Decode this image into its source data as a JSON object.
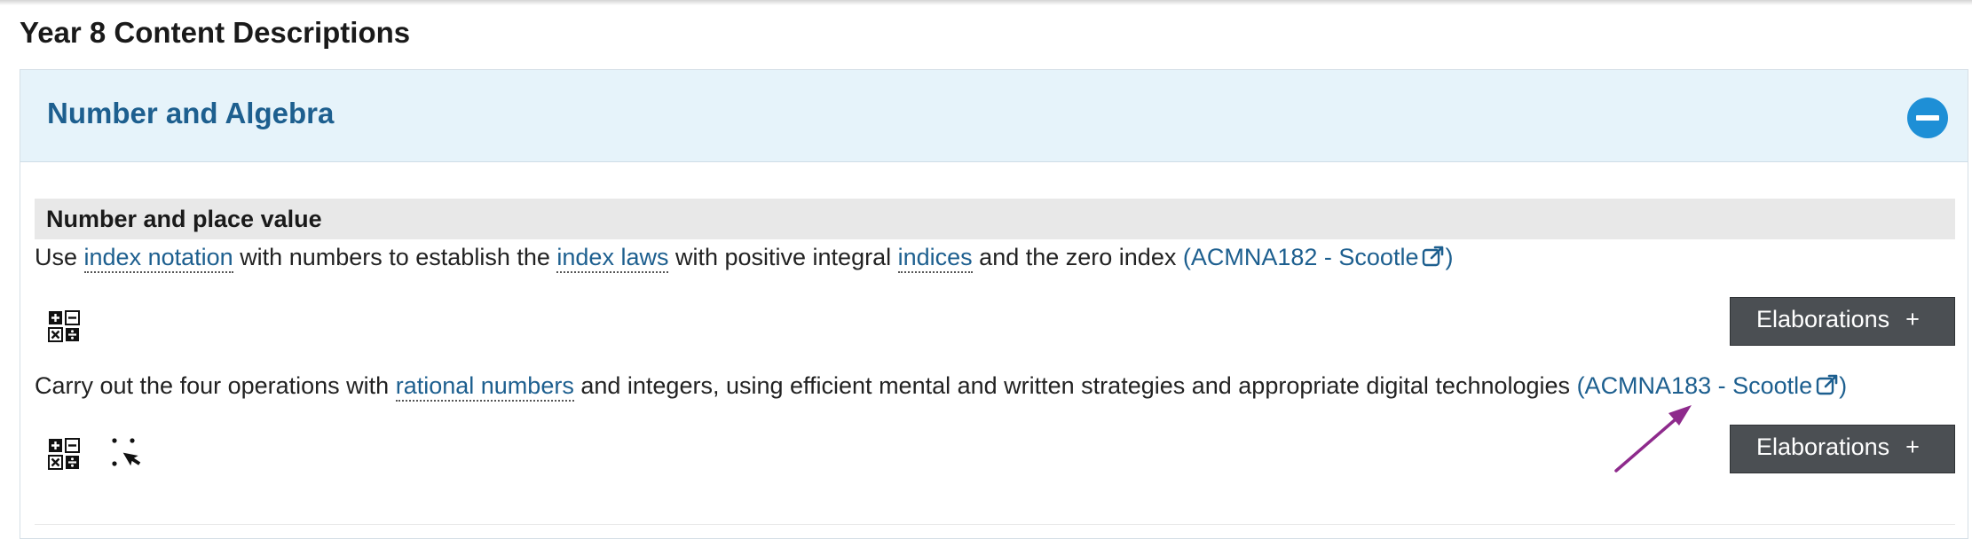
{
  "page": {
    "title": "Year 8 Content Descriptions"
  },
  "strand": {
    "title": "Number and Algebra",
    "collapse_icon": "minus-circle-icon",
    "accent_color": "#1e8fd6",
    "header_bg": "#e6f3fa"
  },
  "substrand": {
    "title": "Number and place value"
  },
  "descriptions": [
    {
      "parts": {
        "t1": "Use",
        "l1": "index notation",
        "t2": "with numbers to establish the",
        "l2": "index laws",
        "t3": "with positive integral",
        "l3": "indices",
        "t4": "and the zero index",
        "code_open": "(ACMNA182 - Scootle",
        "code_close": ")"
      },
      "icons": [
        "numeracy-icon"
      ],
      "button": {
        "label": "Elaborations",
        "plus": "+"
      }
    },
    {
      "parts": {
        "t1": "Carry out the four operations with",
        "l1": "rational numbers",
        "t2": "and integers, using efficient mental and written strategies and appropriate digital technologies",
        "code_open": "(ACMNA183 - Scootle",
        "code_close": ")"
      },
      "icons": [
        "numeracy-icon",
        "ict-capability-icon"
      ],
      "button": {
        "label": "Elaborations",
        "plus": "+"
      }
    }
  ],
  "annotation": {
    "arrow_color": "#8e2a8c"
  }
}
